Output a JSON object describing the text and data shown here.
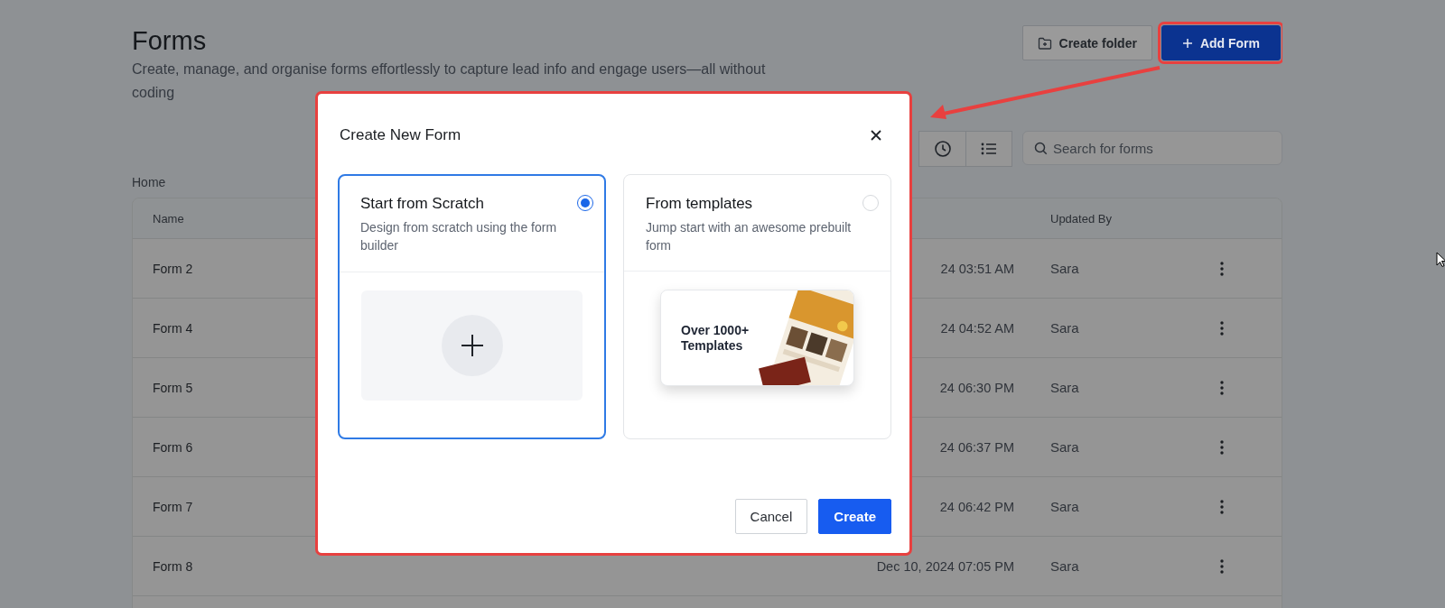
{
  "page": {
    "title": "Forms",
    "subtitle": "Create, manage, and organise forms effortlessly to capture lead info and engage users—all without coding",
    "actions": [
      {
        "label": "Create folder",
        "kind": "secondary",
        "highlighted": false
      },
      {
        "label": "Add Form",
        "kind": "primary",
        "highlighted": true
      }
    ]
  },
  "search": {
    "placeholder": "Search for forms"
  },
  "breadcrumb": "Home",
  "table": {
    "columns": [
      {
        "label": "Name",
        "kind": "name"
      },
      {
        "label": "Updated By",
        "kind": "user"
      }
    ],
    "rows": [
      {
        "name": "Form 2",
        "updated": "24 03:51 AM",
        "updated_by": "Sara"
      },
      {
        "name": "Form 4",
        "updated": "24 04:52 AM",
        "updated_by": "Sara"
      },
      {
        "name": "Form 5",
        "updated": "24 06:30 PM",
        "updated_by": "Sara"
      },
      {
        "name": "Form 6",
        "updated": "24 06:37 PM",
        "updated_by": "Sara"
      },
      {
        "name": "Form 7",
        "updated": "24 06:42 PM",
        "updated_by": "Sara"
      },
      {
        "name": "Form 8",
        "updated": "Dec 10, 2024 07:05 PM",
        "updated_by": "Sara"
      }
    ]
  },
  "dialog": {
    "title": "Create New Form",
    "highlighted": true,
    "options": [
      {
        "title": "Start from Scratch",
        "description": "Design from scratch using the form builder",
        "selected": true,
        "kind": "blank"
      },
      {
        "title": "From templates",
        "description": "Jump start with an awesome prebuilt form",
        "selected": false,
        "kind": "templates",
        "preview_text": "Over 1000+ Templates"
      }
    ],
    "buttons": [
      {
        "label": "Cancel",
        "kind": "secondary"
      },
      {
        "label": "Create",
        "kind": "primary"
      }
    ]
  }
}
